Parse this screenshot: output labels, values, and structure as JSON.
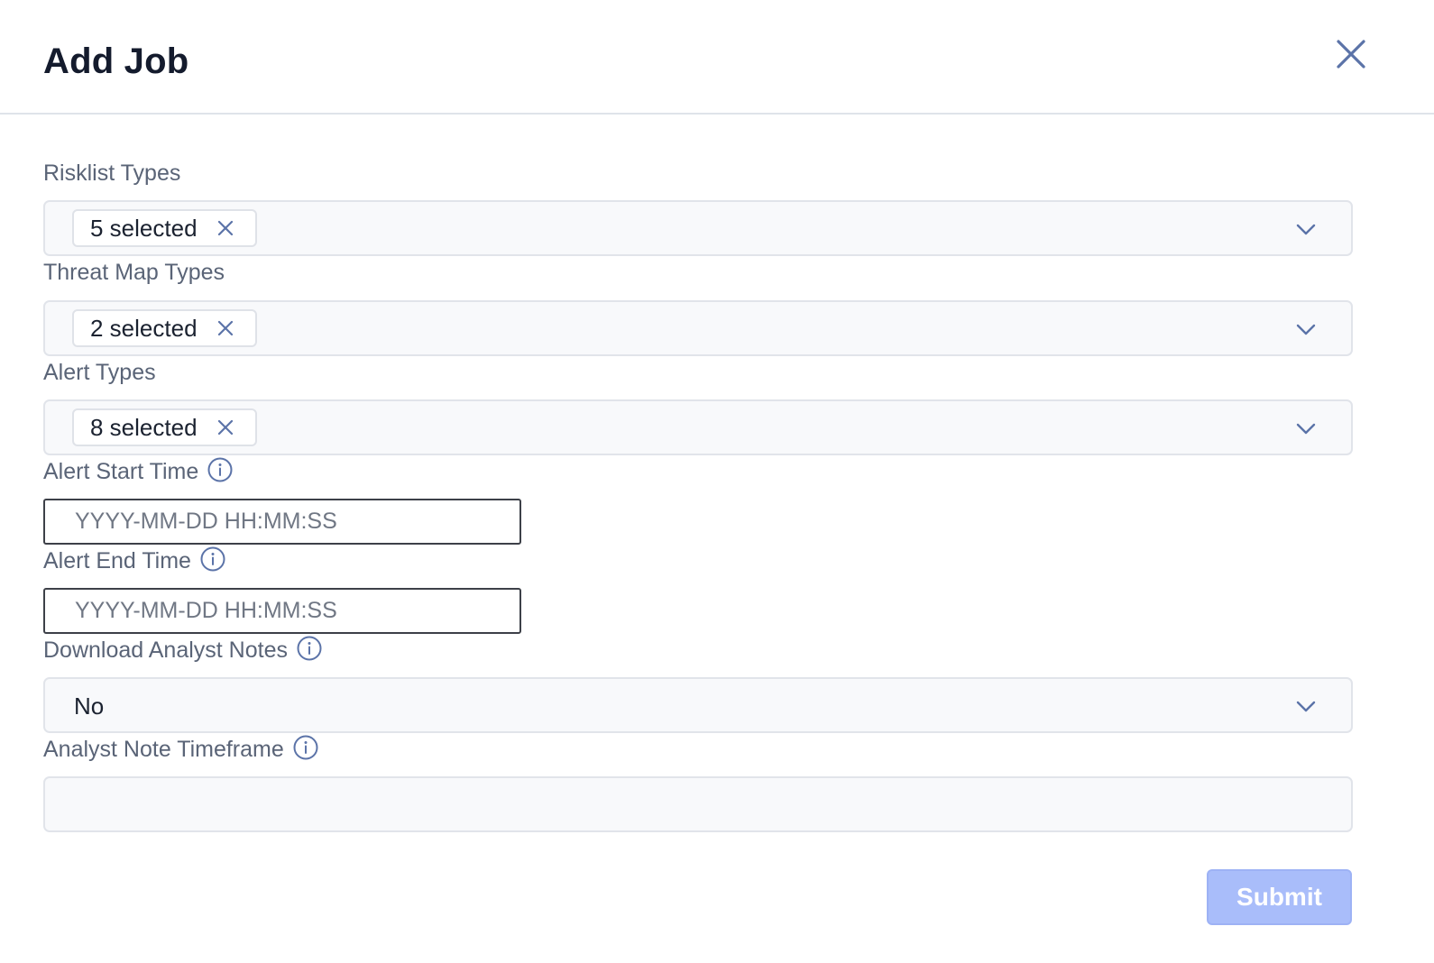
{
  "modal": {
    "title": "Add Job"
  },
  "fields": {
    "risklist_types": {
      "label": "Risklist Types",
      "chip": "5 selected"
    },
    "threat_map_types": {
      "label": "Threat Map Types",
      "chip": "2 selected"
    },
    "alert_types": {
      "label": "Alert Types",
      "chip": "8 selected"
    },
    "alert_start_time": {
      "label": "Alert Start Time",
      "placeholder": "YYYY-MM-DD HH:MM:SS",
      "value": ""
    },
    "alert_end_time": {
      "label": "Alert End Time",
      "placeholder": "YYYY-MM-DD HH:MM:SS",
      "value": ""
    },
    "download_analyst_notes": {
      "label": "Download Analyst Notes",
      "value": "No"
    },
    "analyst_note_timeframe": {
      "label": "Analyst Note Timeframe",
      "value": ""
    }
  },
  "actions": {
    "submit_label": "Submit"
  },
  "icons": {
    "close": "close-icon",
    "chip_remove": "x-icon",
    "dropdown": "chevron-down-icon",
    "info": "info-icon"
  },
  "colors": {
    "title": "#141b2d",
    "label": "#5a6477",
    "icon_accent": "#5b73a8",
    "submit_bg_disabled": "#a9bdfa",
    "field_bg": "#f8f9fb"
  }
}
